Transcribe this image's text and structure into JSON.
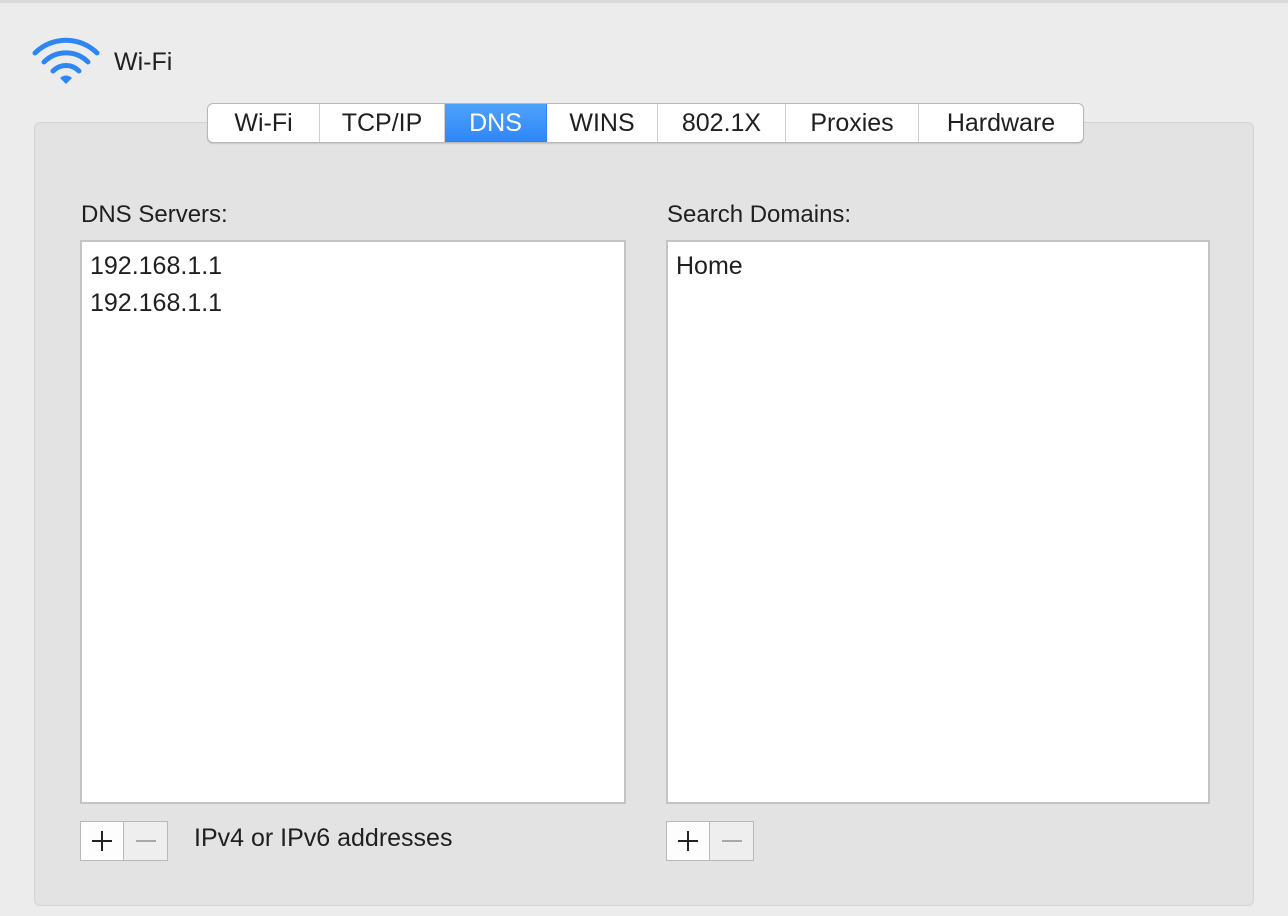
{
  "header": {
    "title": "Wi-Fi",
    "icon": "wifi-icon",
    "icon_color": "#2e86f5"
  },
  "tabs": [
    {
      "label": "Wi-Fi",
      "active": false
    },
    {
      "label": "TCP/IP",
      "active": false
    },
    {
      "label": "DNS",
      "active": true
    },
    {
      "label": "WINS",
      "active": false
    },
    {
      "label": "802.1X",
      "active": false
    },
    {
      "label": "Proxies",
      "active": false
    },
    {
      "label": "Hardware",
      "active": false
    }
  ],
  "accent_color": "#2d86f6",
  "dns_servers": {
    "label": "DNS Servers:",
    "items": [
      "192.168.1.1",
      "192.168.1.1"
    ],
    "add_icon": "plus-icon",
    "remove_icon": "minus-icon",
    "hint": "IPv4 or IPv6 addresses"
  },
  "search_domains": {
    "label": "Search Domains:",
    "items": [
      "Home"
    ],
    "add_icon": "plus-icon",
    "remove_icon": "minus-icon"
  }
}
